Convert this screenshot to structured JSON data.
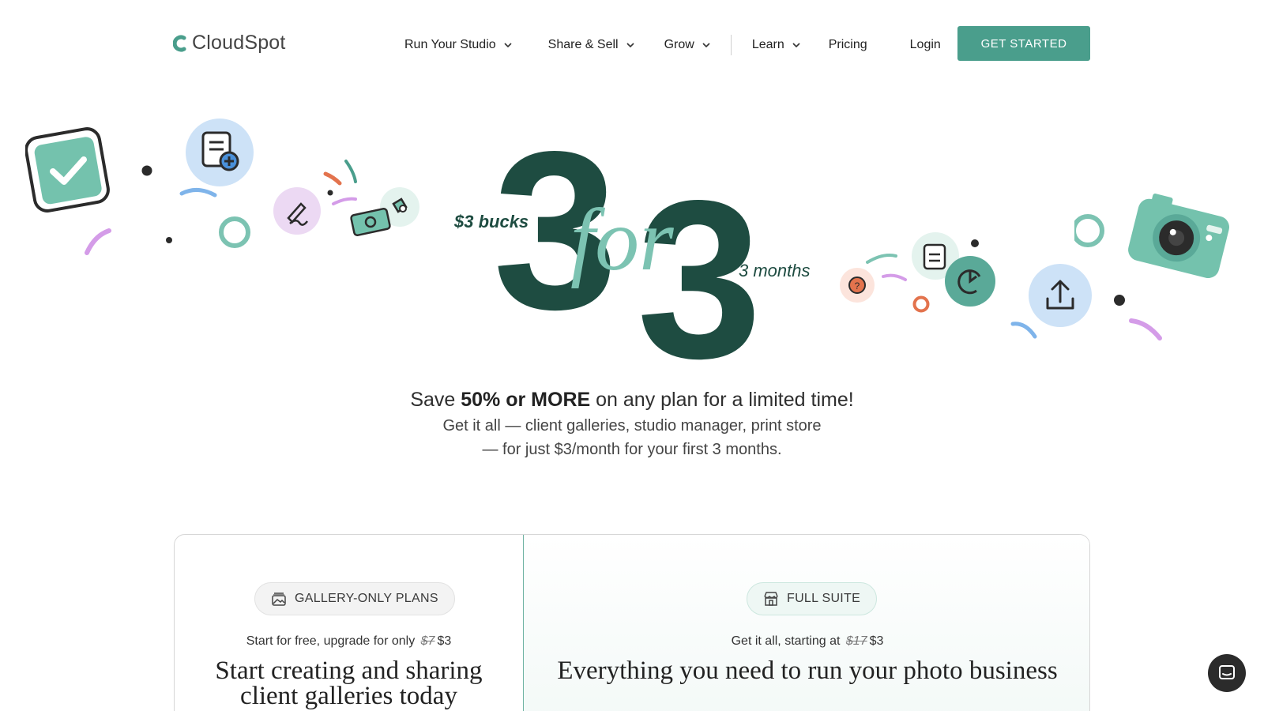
{
  "brand": {
    "name": "CloudSpot",
    "accent": "#4a9e8c",
    "dark_green": "#1e4c41",
    "mint": "#7cc3b2"
  },
  "nav": {
    "items": [
      {
        "label": "Run Your Studio",
        "has_dropdown": true
      },
      {
        "label": "Share & Sell",
        "has_dropdown": true
      },
      {
        "label": "Grow",
        "has_dropdown": true
      },
      {
        "label": "Learn",
        "has_dropdown": true
      },
      {
        "label": "Pricing",
        "has_dropdown": false
      }
    ],
    "login": "Login",
    "cta": "GET STARTED"
  },
  "hero": {
    "bucks": "$3 bucks",
    "digit_a": "3",
    "for_word": "for",
    "digit_b": "3",
    "months": "3 months",
    "headline_pre": "Save ",
    "headline_bold": "50% or MORE",
    "headline_post": " on any plan for a limited time!",
    "sub_line1": "Get it all — client galleries, studio manager, print store",
    "sub_line2": "— for just $3/month for your first 3 months."
  },
  "plans": {
    "left": {
      "pill_label": "GALLERY-ONLY PLANS",
      "pill_icon": "gallery-icon",
      "price_pre": "Start for free, upgrade for only ",
      "price_old": "$7",
      "price_new": "$3",
      "title_line1": "Start creating and sharing",
      "title_line2": "client galleries today"
    },
    "right": {
      "pill_label": "FULL SUITE",
      "pill_icon": "storefront-icon",
      "price_pre": "Get it all, starting at ",
      "price_old": "$17",
      "price_new": "$3",
      "title_line1": "Everything you need to run your photo business"
    }
  },
  "chat": {
    "icon": "chat-bubble-icon"
  }
}
